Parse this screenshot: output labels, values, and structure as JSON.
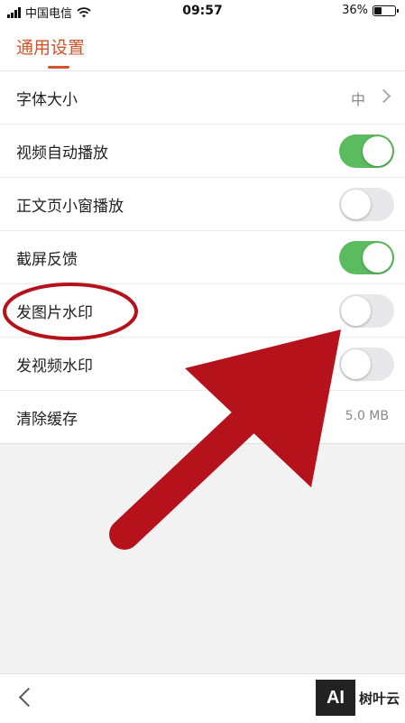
{
  "status_bar": {
    "carrier": "中国电信",
    "time": "09:57",
    "battery_text": "36%",
    "battery_level": 0.36
  },
  "header": {
    "title": "通用设置"
  },
  "settings": {
    "rows": [
      {
        "label": "字体大小",
        "value": "中",
        "type": "chevron"
      },
      {
        "label": "视频自动播放",
        "type": "toggle",
        "on": true
      },
      {
        "label": "正文页小窗播放",
        "type": "toggle",
        "on": false
      },
      {
        "label": "截屏反馈",
        "type": "toggle",
        "on": true
      },
      {
        "label": "发图片水印",
        "type": "toggle",
        "on": false
      },
      {
        "label": "发视频水印",
        "type": "toggle",
        "on": false
      },
      {
        "label": "清除缓存",
        "value": "5.0 MB",
        "type": "value"
      }
    ]
  },
  "watermark": {
    "logo": "AI",
    "text": "树叶云"
  },
  "colors": {
    "accent": "#d0532a",
    "toggle_on": "#5bbc5f",
    "toggle_off": "#e8e8ea",
    "annotation": "#b5121b"
  },
  "icons": {
    "signal": "signal-icon",
    "wifi": "wifi-icon",
    "battery": "battery-icon",
    "chevron": "chevron-right-icon",
    "back": "back-arrow-icon"
  }
}
